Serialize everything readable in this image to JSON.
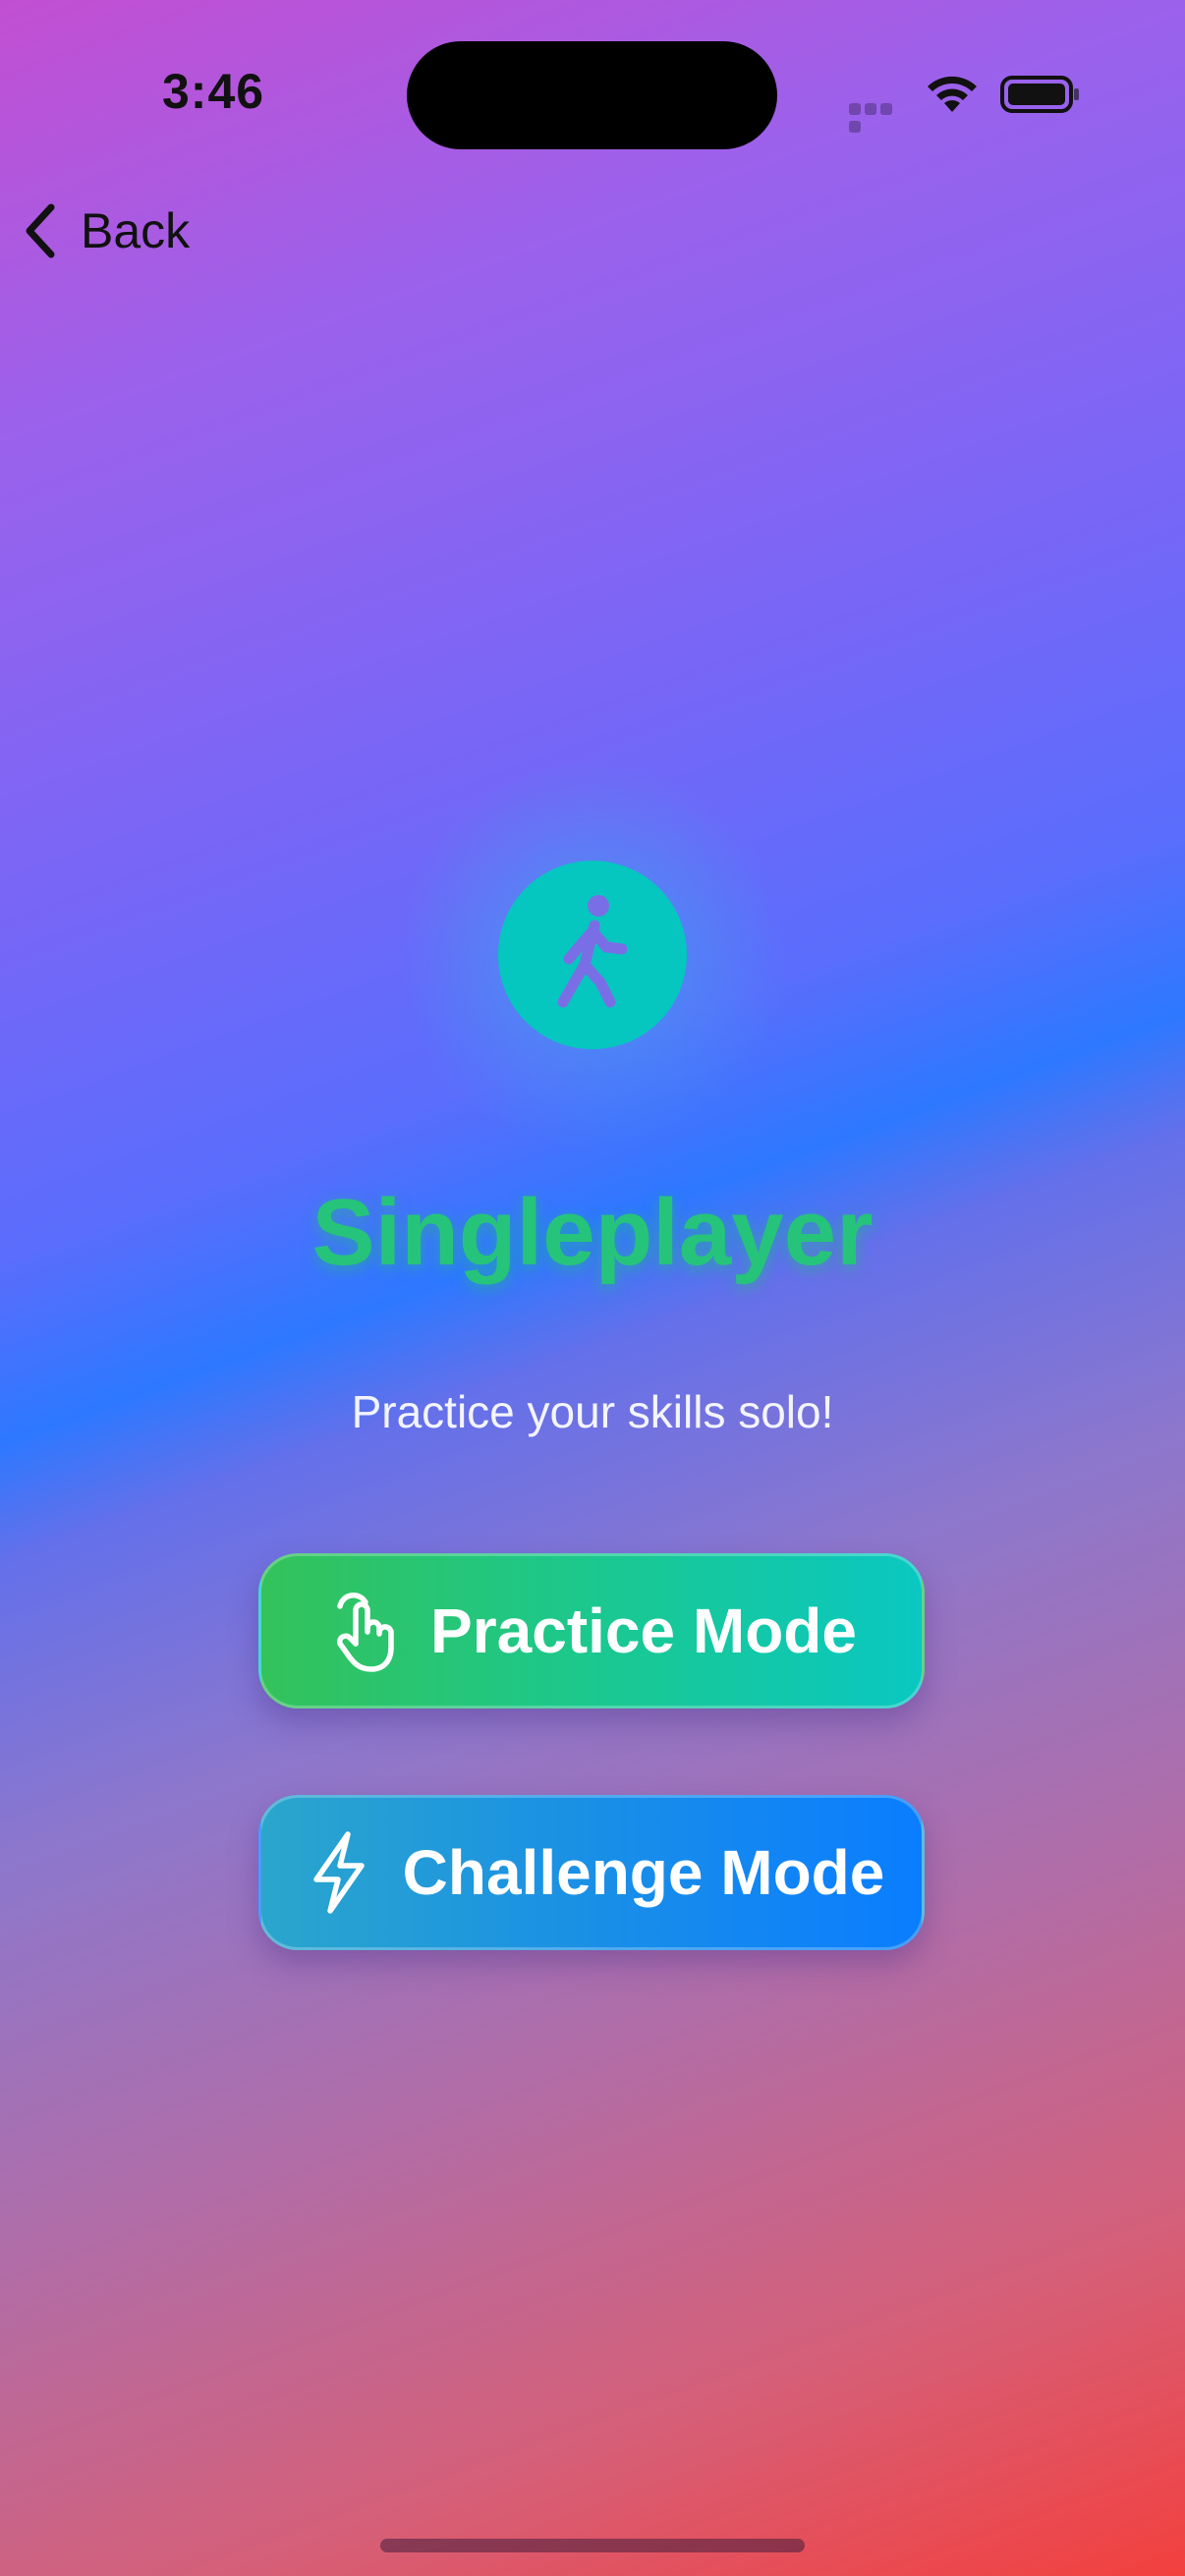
{
  "status_bar": {
    "time": "3:46"
  },
  "nav": {
    "back_label": "Back"
  },
  "hero": {
    "icon": "figure-walk-icon",
    "title": "Singleplayer",
    "subtitle": "Practice your skills solo!"
  },
  "modes": [
    {
      "label": "Practice Mode",
      "icon": "hand-tap-icon"
    },
    {
      "label": "Challenge Mode",
      "icon": "bolt-icon"
    }
  ],
  "colors": {
    "title": "#26c47a",
    "hero_icon_bg": "#06c6c0",
    "practice_gradient": [
      "#34c25a",
      "#0ac8c2"
    ],
    "challenge_gradient": [
      "#2aa6cc",
      "#0a7dff"
    ]
  }
}
